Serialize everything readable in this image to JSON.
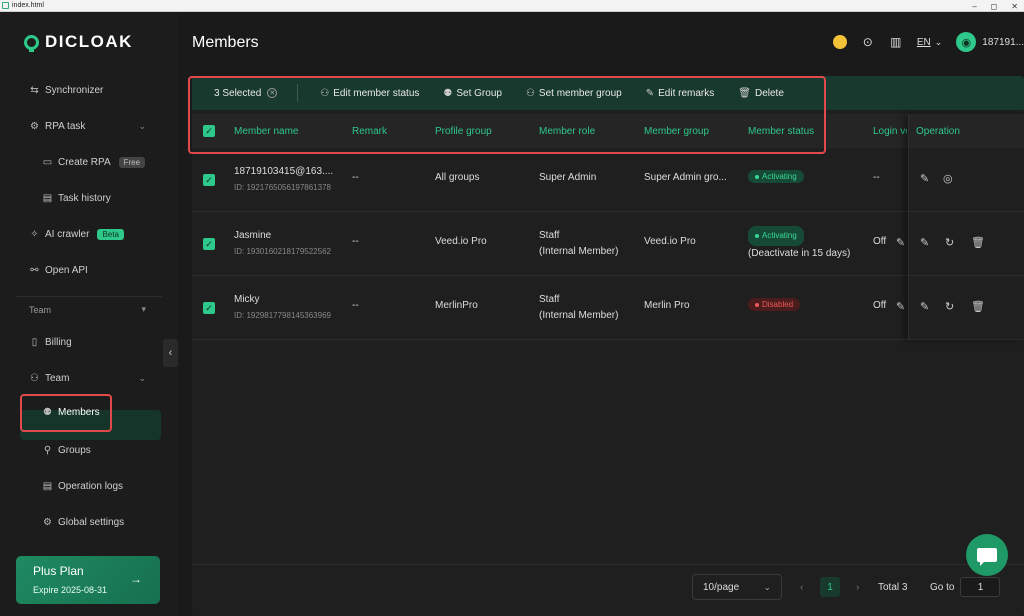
{
  "window": {
    "title": "index.html",
    "controls": [
      "–",
      "◻",
      "✕"
    ]
  },
  "app": {
    "brand": "DICLOAK"
  },
  "sidebar": {
    "items": [
      {
        "label": "Synchronizer",
        "icon": "sync-icon"
      },
      {
        "label": "RPA task",
        "icon": "robot-icon"
      },
      {
        "label": "Create RPA",
        "icon": "create-icon",
        "badge": "Free"
      },
      {
        "label": "Task history",
        "icon": "history-icon"
      },
      {
        "label": "AI crawler",
        "icon": "ai-icon",
        "badge": "Beta"
      },
      {
        "label": "Open API",
        "icon": "api-icon"
      },
      {
        "label": "Billing",
        "icon": "billing-icon"
      },
      {
        "label": "Team",
        "icon": "team-icon"
      },
      {
        "label": "Members",
        "icon": "members-icon",
        "active": true
      },
      {
        "label": "Groups",
        "icon": "groups-icon"
      },
      {
        "label": "Operation logs",
        "icon": "logs-icon"
      },
      {
        "label": "Global settings",
        "icon": "settings-icon"
      }
    ],
    "section_team": "Team",
    "plan": {
      "name": "Plus Plan",
      "expire": "Expire 2025-08-31",
      "arrow": "→"
    }
  },
  "header": {
    "title": "Members",
    "lang": "EN",
    "user": "187191..."
  },
  "toolbar": {
    "selected": "3 Selected",
    "edit_status": "Edit member status",
    "set_group": "Set Group",
    "set_member_group": "Set member group",
    "edit_remarks": "Edit remarks",
    "delete": "Delete"
  },
  "table": {
    "columns": [
      "Member name",
      "Remark",
      "Profile group",
      "Member role",
      "Member group",
      "Member status",
      "Login ve",
      "Operation"
    ],
    "rows": [
      {
        "name": "18719103415@163....",
        "id": "ID: 1921765056197861378",
        "remark": "--",
        "profile_group": "All groups",
        "role": "Super Admin",
        "role2": "",
        "member_group": "Super Admin gro...",
        "status": "Activating",
        "status_note": "",
        "login": "--"
      },
      {
        "name": "Jasmine",
        "id": "ID: 1930160218179522562",
        "remark": "--",
        "profile_group": "Veed.io Pro",
        "role": "Staff",
        "role2": "(Internal Member)",
        "member_group": "Veed.io Pro",
        "status": "Activating",
        "status_note": "(Deactivate in 15 days)",
        "login": "Off"
      },
      {
        "name": "Micky",
        "id": "ID: 1929817798145363969",
        "remark": "--",
        "profile_group": "MerlinPro",
        "role": "Staff",
        "role2": "(Internal Member)",
        "member_group": "Merlin Pro",
        "status": "Disabled",
        "status_note": "",
        "login": "Off"
      }
    ]
  },
  "pagination": {
    "page_size": "10/page",
    "current": "1",
    "total": "Total 3",
    "goto_label": "Go to",
    "goto_value": "1"
  },
  "colors": {
    "accent": "#2ec88a",
    "danger": "#e04a4a"
  }
}
